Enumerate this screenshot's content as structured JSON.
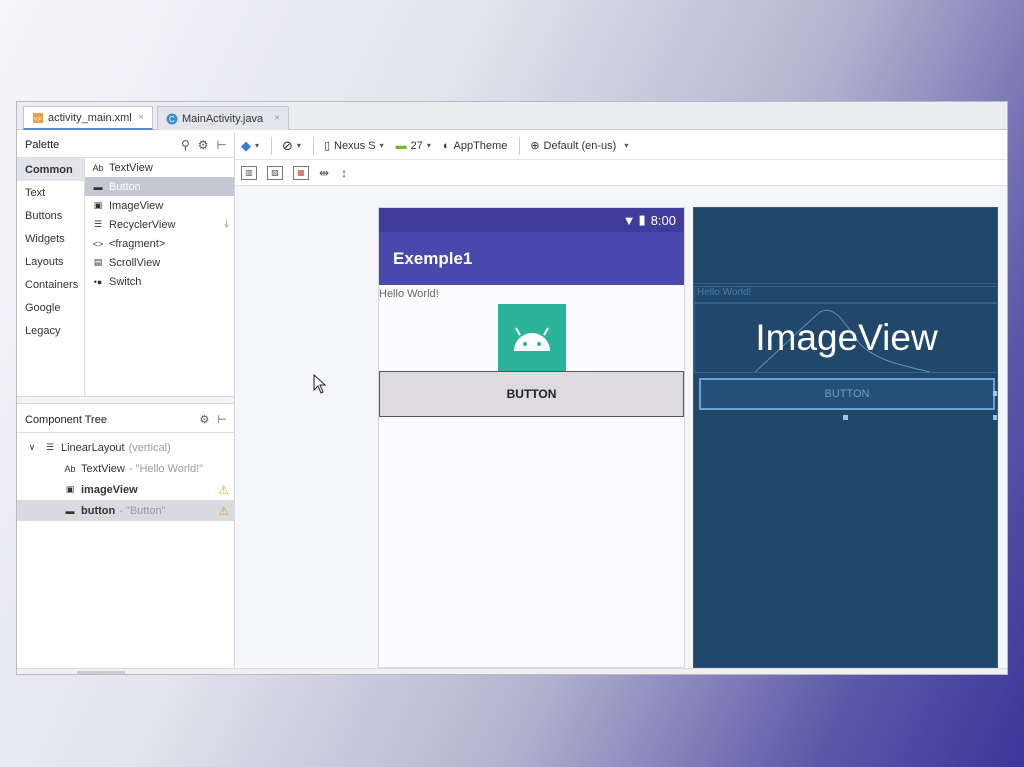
{
  "tabs": [
    {
      "label": "activity_main.xml",
      "close": "×",
      "icon": "xml-file-icon"
    },
    {
      "label": "MainActivity.java",
      "close": "×",
      "icon": "java-class-icon"
    }
  ],
  "palette": {
    "title": "Palette",
    "categories": [
      "Common",
      "Text",
      "Buttons",
      "Widgets",
      "Layouts",
      "Containers",
      "Google",
      "Legacy"
    ],
    "widgets": [
      {
        "icon": "Ab",
        "label": "TextView"
      },
      {
        "icon": "▬",
        "label": "Button"
      },
      {
        "icon": "▣",
        "label": "ImageView"
      },
      {
        "icon": "☰",
        "label": "RecyclerView"
      },
      {
        "icon": "<>",
        "label": "<fragment>"
      },
      {
        "icon": "▤",
        "label": "ScrollView"
      },
      {
        "icon": "•●",
        "label": "Switch"
      }
    ]
  },
  "component_tree": {
    "title": "Component Tree",
    "rows": [
      {
        "expand": "∨",
        "icon": "☰",
        "label": "LinearLayout",
        "sub": "(vertical)"
      },
      {
        "icon": "Ab",
        "label": "TextView",
        "sub": "- \"Hello World!\""
      },
      {
        "icon": "▣",
        "label": "imageView",
        "sub": ""
      },
      {
        "icon": "▬",
        "label": "button",
        "sub": "- \"Button\""
      }
    ]
  },
  "toolbar": {
    "device": "Nexus S",
    "api": "27",
    "theme": "AppTheme",
    "locale": "Default (en-us)"
  },
  "phone": {
    "time": "8:00",
    "app_title": "Exemple1",
    "hello_text": "Hello World!",
    "button_label": "BUTTON"
  },
  "blueprint": {
    "hello_text": "Hello World!",
    "image_label": "ImageView",
    "button_label": "BUTTON"
  },
  "colors": {
    "primary": "#4a47ad",
    "primary_dark": "#3f3c9b",
    "android_green": "#2bb39a",
    "blueprint": "#21476a"
  }
}
